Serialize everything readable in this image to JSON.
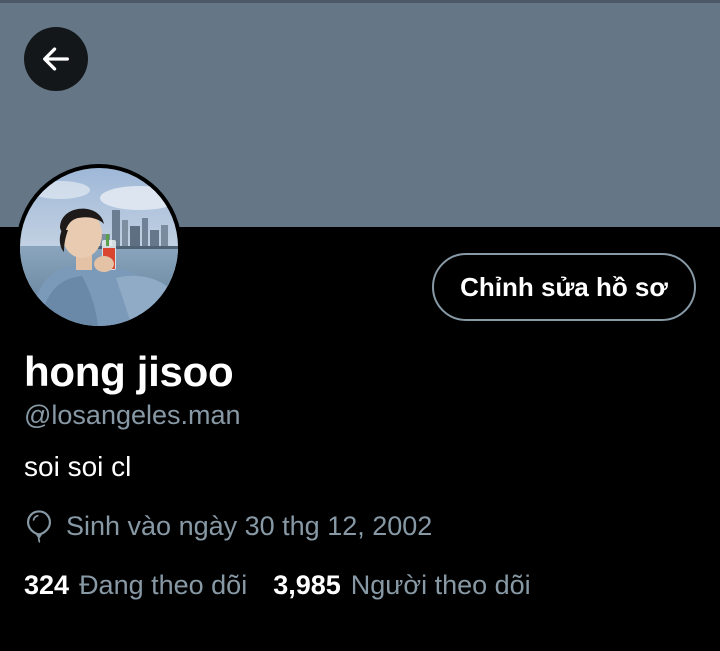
{
  "colors": {
    "banner": "#657786",
    "background": "#000000",
    "secondary_text": "#8899a6",
    "primary_text": "#ffffff"
  },
  "header": {
    "back_icon": "arrow-left-icon"
  },
  "profile": {
    "avatar_icon": "profile-photo",
    "edit_button_label": "Chỉnh sửa hồ sơ",
    "display_name": "hong jisoo",
    "handle": "@losangeles.man",
    "bio": "soi soi cl",
    "birthday_icon": "balloon-icon",
    "birthday": "Sinh vào ngày 30 thg 12, 2002",
    "following_count": "324",
    "following_label": "Đang theo dõi",
    "followers_count": "3,985",
    "followers_label": "Người theo dõi"
  }
}
